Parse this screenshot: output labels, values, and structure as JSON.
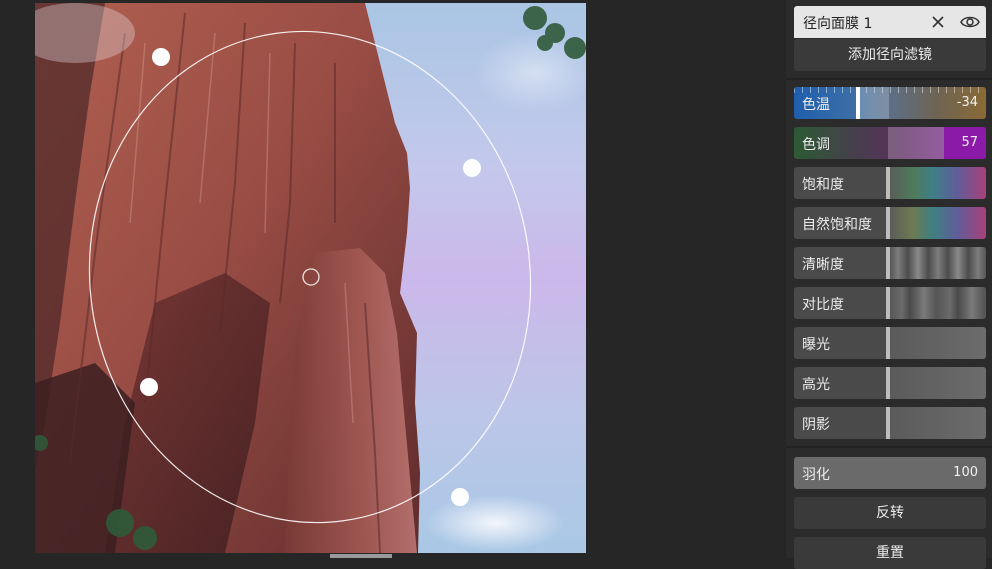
{
  "mask_panel": {
    "title": "径向面膜 1",
    "close_icon": "close-icon",
    "visibility_icon": "eye-icon",
    "add_button": "添加径向滤镜"
  },
  "adjustments": [
    {
      "label": "色温",
      "value": "-34"
    },
    {
      "label": "色调",
      "value": "57"
    },
    {
      "label": "饱和度",
      "value": ""
    },
    {
      "label": "自然饱和度",
      "value": ""
    },
    {
      "label": "清晰度",
      "value": ""
    },
    {
      "label": "对比度",
      "value": ""
    },
    {
      "label": "曝光",
      "value": ""
    },
    {
      "label": "高光",
      "value": ""
    },
    {
      "label": "阴影",
      "value": ""
    }
  ],
  "feather": {
    "label": "羽化",
    "value": "100"
  },
  "actions": {
    "invert": "反转",
    "reset": "重置"
  },
  "colors": {
    "accent_blue": "#1e5fb0",
    "accent_purple": "#8c1aa8",
    "panel_bg": "#2b2b2b"
  }
}
